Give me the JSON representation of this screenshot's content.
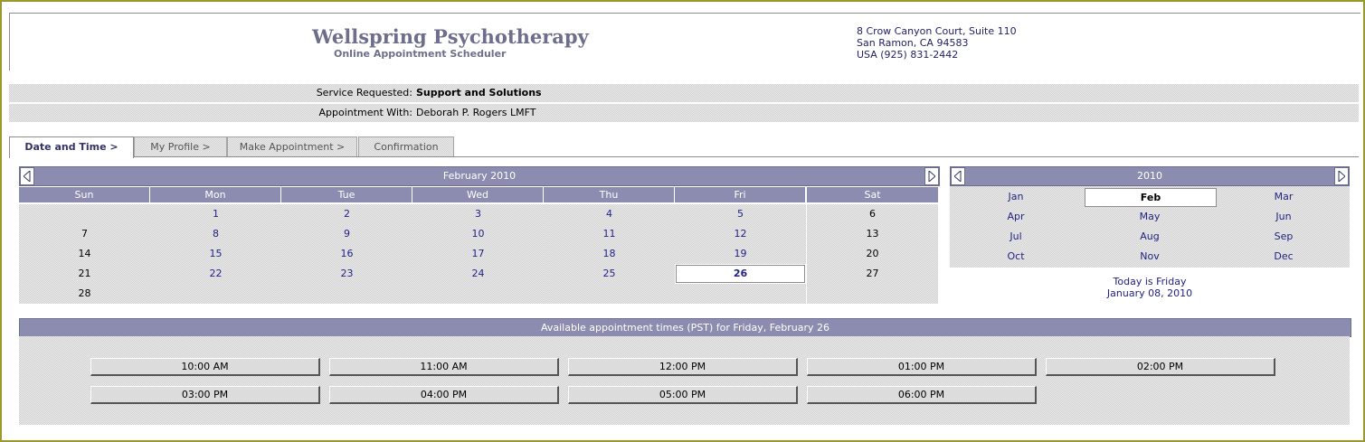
{
  "header": {
    "title": "Wellspring Psychotherapy",
    "subtitle": "Online Appointment Scheduler",
    "address": [
      "8 Crow Canyon Court, Suite 110",
      "San Ramon, CA 94583",
      "USA  (925) 831-2442"
    ]
  },
  "info": {
    "service_label": "Service Requested:",
    "service_value": "Support and Solutions",
    "appointment_label": "Appointment With:",
    "appointment_value": "Deborah P. Rogers LMFT"
  },
  "tabs": [
    {
      "label": "Date and Time >"
    },
    {
      "label": "My Profile >"
    },
    {
      "label": "Make Appointment >"
    },
    {
      "label": "Confirmation"
    }
  ],
  "calendar": {
    "month_title": "February 2010",
    "days_of_week": [
      "Sun",
      "Mon",
      "Tue",
      "Wed",
      "Thu",
      "Fri",
      "Sat"
    ],
    "weeks": [
      [
        "",
        "1",
        "2",
        "3",
        "4",
        "5",
        "6"
      ],
      [
        "7",
        "8",
        "9",
        "10",
        "11",
        "12",
        "13"
      ],
      [
        "14",
        "15",
        "16",
        "17",
        "18",
        "19",
        "20"
      ],
      [
        "21",
        "22",
        "23",
        "24",
        "25",
        "26",
        "27"
      ],
      [
        "28",
        "",
        "",
        "",
        "",
        "",
        ""
      ]
    ],
    "selected_day": "26"
  },
  "year_calendar": {
    "year_title": "2010",
    "months": [
      "Jan",
      "Feb",
      "Mar",
      "Apr",
      "May",
      "Jun",
      "Jul",
      "Aug",
      "Sep",
      "Oct",
      "Nov",
      "Dec"
    ],
    "selected_month": "Feb",
    "today_line1": "Today is Friday",
    "today_line2": "January 08, 2010"
  },
  "available": {
    "heading": "Available appointment times (PST) for Friday, February 26",
    "times": [
      "10:00 AM",
      "11:00 AM",
      "12:00 PM",
      "01:00 PM",
      "02:00 PM",
      "03:00 PM",
      "04:00 PM",
      "05:00 PM",
      "06:00 PM"
    ]
  },
  "colors": {
    "header_bar": "#8c8cb0",
    "link": "#222288",
    "title": "#6e6e8c",
    "frame": "#9a9a2c"
  }
}
